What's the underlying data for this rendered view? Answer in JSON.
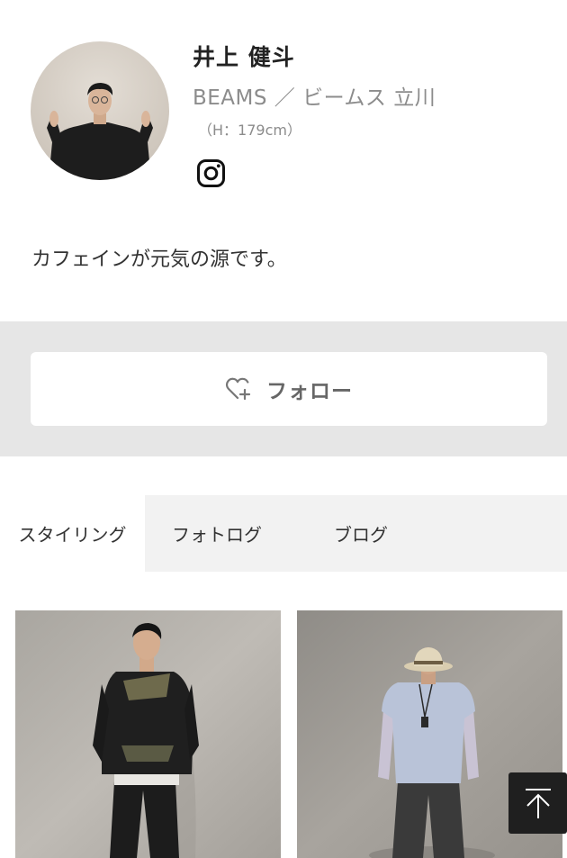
{
  "profile": {
    "name": "井上 健斗",
    "shop": "BEAMS ／ ビームス 立川",
    "height": "（H：179cm）",
    "bio": "カフェインが元気の源です。",
    "social_icon": "instagram-icon"
  },
  "follow": {
    "label": "フォロー",
    "icon": "heart-plus-icon"
  },
  "tabs": [
    {
      "label": "スタイリング",
      "active": true
    },
    {
      "label": "フォトログ",
      "active": false
    },
    {
      "label": "ブログ",
      "active": false
    }
  ],
  "back_to_top": {
    "icon": "arrow-up-to-top-icon"
  },
  "colors": {
    "band": "#e6e6e6",
    "tab_bar": "#f2f2f2",
    "muted_text": "#8c8c8c",
    "back_to_top_bg": "#1f1f1f"
  }
}
